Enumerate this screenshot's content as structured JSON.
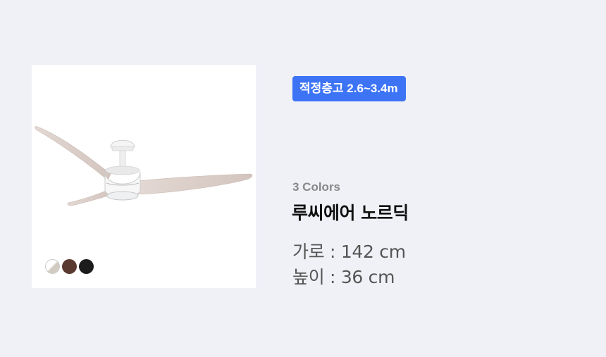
{
  "product": {
    "height_badge": "적정층고 2.6~3.4m",
    "colors_count": "3 Colors",
    "name": "루씨에어 노르딕",
    "dimensions": [
      "가로 : 142 cm",
      "높이 : 36 cm"
    ],
    "swatches": [
      {
        "name": "white",
        "color": "#e8e4de"
      },
      {
        "name": "brown",
        "color": "#5a3a30"
      },
      {
        "name": "black",
        "color": "#1c1c1c"
      }
    ],
    "image_subject": "ceiling-fan"
  },
  "colors": {
    "badge_bg": "#3d73f5",
    "page_bg": "#f0f1f7"
  }
}
